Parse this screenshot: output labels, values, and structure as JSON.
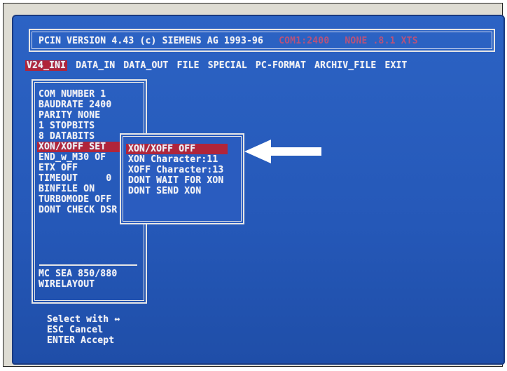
{
  "title": {
    "main": "PCIN VERSION 4.43 (c) SIEMENS AG 1993-96",
    "port": "COM1:2400",
    "mode": "NONE .8.1 XTS"
  },
  "menu": [
    "V24_INI",
    "DATA_IN",
    "DATA_OUT",
    "FILE",
    "SPECIAL",
    "PC-FORMAT",
    "ARCHIV_FILE",
    "EXIT"
  ],
  "menu_active": "V24_INI",
  "settings": [
    "COM NUMBER 1",
    "BAUDRATE 2400",
    "PARITY NONE",
    "1 STOPBITS",
    "8 DATABITS",
    "XON/XOFF SET",
    "END_w_M30 OF",
    "ETX OFF",
    "TIMEOUT     0",
    "BINFILE ON",
    "TURBOMODE OFF",
    "DONT CHECK DSR"
  ],
  "settings_extra": [
    "MC SEA 850/880",
    "WIRELAYOUT"
  ],
  "submenu": [
    "XON/XOFF OFF",
    "XON Character:11",
    "XOFF Character:13",
    "DONT WAIT FOR XON",
    "DONT SEND XON"
  ],
  "footer": [
    "Select with ↔",
    "ESC Cancel",
    "ENTER Accept"
  ],
  "colors": {
    "screen": "#2558b8",
    "highlight": "#b0253a",
    "text": "#f2f2f2"
  }
}
